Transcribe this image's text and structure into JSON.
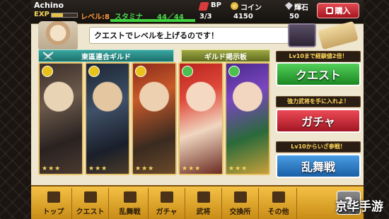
{
  "status": {
    "player_name": "Achino",
    "exp_label": "EXP",
    "exp_progress": 0.45,
    "level_text": "レベル:8",
    "stamina_label": "スタミナ",
    "stamina_value": "44／44",
    "stamina_progress": 1.0,
    "bp_label": "BP",
    "bp_value": "3/3",
    "coin_label": "コイン",
    "coin_value": "4150",
    "gem_label": "輝石",
    "gem_value": "50",
    "buy_label": "購入"
  },
  "message": "クエストでレベルを上げるのです！",
  "guild": {
    "name": "東區連合ギルド",
    "board": "ギルド掲示板"
  },
  "cards": [
    {
      "stars": "★★★",
      "attr_color": "#e8c21a"
    },
    {
      "stars": "★★★",
      "attr_color": "#e8c21a"
    },
    {
      "stars": "★★★",
      "attr_color": "#e8c21a"
    },
    {
      "stars": "★★★",
      "attr_color": "#4cc04c"
    },
    {
      "stars": "★★★",
      "attr_color": "#4cc04c"
    }
  ],
  "menu": {
    "quest_banner": "Lv10まで経験値2倍！",
    "quest_label": "クエスト",
    "gacha_banner": "強力武将を手に入れよ！",
    "gacha_label": "ガチャ",
    "ranbu_banner": "Lv10からいざ参戦！",
    "ranbu_label": "乱舞戦"
  },
  "nav": [
    {
      "label": "トップ"
    },
    {
      "label": "クエスト"
    },
    {
      "label": "乱舞戦"
    },
    {
      "label": "ガチャ"
    },
    {
      "label": "武将"
    },
    {
      "label": "交換所"
    },
    {
      "label": "その他"
    }
  ],
  "help_label": "?",
  "watermark": "京华手游"
}
